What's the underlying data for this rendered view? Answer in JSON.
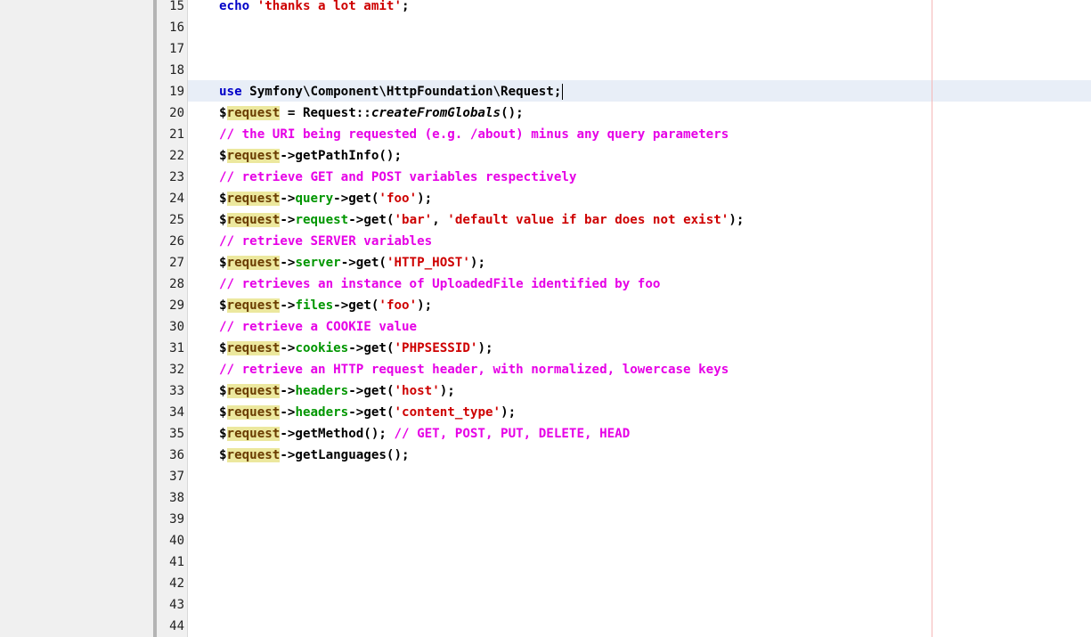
{
  "editor": {
    "current_line": 19,
    "lines": [
      {
        "n": "15",
        "tokens": [
          {
            "t": "echo",
            "k": "kw"
          },
          {
            "t": " ",
            "k": ""
          },
          {
            "t": "'thanks a lot amit'",
            "k": "str"
          },
          {
            "t": ";",
            "k": ""
          }
        ]
      },
      {
        "n": "16",
        "tokens": []
      },
      {
        "n": "17",
        "tokens": []
      },
      {
        "n": "18",
        "tokens": []
      },
      {
        "n": "19",
        "tokens": [
          {
            "t": "use",
            "k": "kw"
          },
          {
            "t": " Symfony\\Component\\HttpFoundation\\Request;",
            "k": ""
          }
        ],
        "caret": true
      },
      {
        "n": "20",
        "tokens": [
          {
            "t": "$",
            "k": ""
          },
          {
            "t": "request",
            "k": "var"
          },
          {
            "t": " = Request::",
            "k": ""
          },
          {
            "t": "createFromGlobals",
            "k": "it"
          },
          {
            "t": "();",
            "k": ""
          }
        ]
      },
      {
        "n": "21",
        "tokens": [
          {
            "t": "// the URI being requested (e.g. /about) minus any query parameters",
            "k": "cmt"
          }
        ]
      },
      {
        "n": "22",
        "tokens": [
          {
            "t": "$",
            "k": ""
          },
          {
            "t": "request",
            "k": "var"
          },
          {
            "t": "->getPathInfo();",
            "k": ""
          }
        ]
      },
      {
        "n": "23",
        "tokens": [
          {
            "t": "// retrieve GET and POST variables respectively",
            "k": "cmt"
          }
        ]
      },
      {
        "n": "24",
        "tokens": [
          {
            "t": "$",
            "k": ""
          },
          {
            "t": "request",
            "k": "var"
          },
          {
            "t": "->",
            "k": ""
          },
          {
            "t": "query",
            "k": "prop"
          },
          {
            "t": "->get(",
            "k": ""
          },
          {
            "t": "'foo'",
            "k": "str"
          },
          {
            "t": ");",
            "k": ""
          }
        ]
      },
      {
        "n": "25",
        "tokens": [
          {
            "t": "$",
            "k": ""
          },
          {
            "t": "request",
            "k": "var"
          },
          {
            "t": "->",
            "k": ""
          },
          {
            "t": "request",
            "k": "prop"
          },
          {
            "t": "->get(",
            "k": ""
          },
          {
            "t": "'bar'",
            "k": "str"
          },
          {
            "t": ", ",
            "k": ""
          },
          {
            "t": "'default value if bar does not exist'",
            "k": "str"
          },
          {
            "t": ");",
            "k": ""
          }
        ]
      },
      {
        "n": "26",
        "tokens": [
          {
            "t": "// retrieve SERVER variables",
            "k": "cmt"
          }
        ]
      },
      {
        "n": "27",
        "tokens": [
          {
            "t": "$",
            "k": ""
          },
          {
            "t": "request",
            "k": "var"
          },
          {
            "t": "->",
            "k": ""
          },
          {
            "t": "server",
            "k": "prop"
          },
          {
            "t": "->get(",
            "k": ""
          },
          {
            "t": "'HTTP_HOST'",
            "k": "str"
          },
          {
            "t": ");",
            "k": ""
          }
        ]
      },
      {
        "n": "28",
        "tokens": [
          {
            "t": "// retrieves an instance of UploadedFile identified by foo",
            "k": "cmt"
          }
        ]
      },
      {
        "n": "29",
        "tokens": [
          {
            "t": "$",
            "k": ""
          },
          {
            "t": "request",
            "k": "var"
          },
          {
            "t": "->",
            "k": ""
          },
          {
            "t": "files",
            "k": "prop"
          },
          {
            "t": "->get(",
            "k": ""
          },
          {
            "t": "'foo'",
            "k": "str"
          },
          {
            "t": ");",
            "k": ""
          }
        ]
      },
      {
        "n": "30",
        "tokens": [
          {
            "t": "// retrieve a COOKIE value",
            "k": "cmt"
          }
        ]
      },
      {
        "n": "31",
        "tokens": [
          {
            "t": "$",
            "k": ""
          },
          {
            "t": "request",
            "k": "var"
          },
          {
            "t": "->",
            "k": ""
          },
          {
            "t": "cookies",
            "k": "prop"
          },
          {
            "t": "->get(",
            "k": ""
          },
          {
            "t": "'PHPSESSID'",
            "k": "str"
          },
          {
            "t": ");",
            "k": ""
          }
        ]
      },
      {
        "n": "32",
        "tokens": [
          {
            "t": "// retrieve an HTTP request header, with normalized, lowercase keys",
            "k": "cmt"
          }
        ]
      },
      {
        "n": "33",
        "tokens": [
          {
            "t": "$",
            "k": ""
          },
          {
            "t": "request",
            "k": "var"
          },
          {
            "t": "->",
            "k": ""
          },
          {
            "t": "headers",
            "k": "prop"
          },
          {
            "t": "->get(",
            "k": ""
          },
          {
            "t": "'host'",
            "k": "str"
          },
          {
            "t": ");",
            "k": ""
          }
        ]
      },
      {
        "n": "34",
        "tokens": [
          {
            "t": "$",
            "k": ""
          },
          {
            "t": "request",
            "k": "var"
          },
          {
            "t": "->",
            "k": ""
          },
          {
            "t": "headers",
            "k": "prop"
          },
          {
            "t": "->get(",
            "k": ""
          },
          {
            "t": "'content_type'",
            "k": "str"
          },
          {
            "t": ");",
            "k": ""
          }
        ]
      },
      {
        "n": "35",
        "tokens": [
          {
            "t": "$",
            "k": ""
          },
          {
            "t": "request",
            "k": "var"
          },
          {
            "t": "->getMethod(); ",
            "k": ""
          },
          {
            "t": "// GET, POST, PUT, DELETE, HEAD",
            "k": "cmt"
          }
        ]
      },
      {
        "n": "36",
        "tokens": [
          {
            "t": "$",
            "k": ""
          },
          {
            "t": "request",
            "k": "var"
          },
          {
            "t": "->getLanguages();",
            "k": ""
          }
        ]
      },
      {
        "n": "37",
        "tokens": []
      },
      {
        "n": "38",
        "tokens": []
      },
      {
        "n": "39",
        "tokens": []
      },
      {
        "n": "40",
        "tokens": []
      },
      {
        "n": "41",
        "tokens": []
      },
      {
        "n": "42",
        "tokens": []
      },
      {
        "n": "43",
        "tokens": []
      },
      {
        "n": "44",
        "tokens": []
      }
    ]
  }
}
